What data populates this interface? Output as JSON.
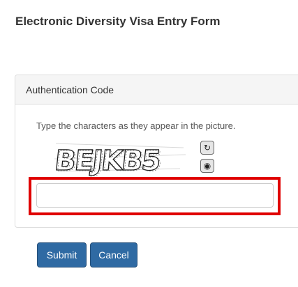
{
  "page": {
    "title": "Electronic Diversity Visa Entry Form"
  },
  "panel": {
    "heading": "Authentication Code",
    "instruction": "Type the characters as they appear in the picture.",
    "captcha_text": "BEJKB5",
    "refresh_icon": "refresh-icon",
    "audio_icon": "audio-icon",
    "input_value": ""
  },
  "actions": {
    "submit_label": "Submit",
    "cancel_label": "Cancel"
  },
  "colors": {
    "highlight": "#e00000",
    "button": "#2f6aa3",
    "panel_border": "#dddddd",
    "panel_heading_bg": "#f5f5f5"
  }
}
